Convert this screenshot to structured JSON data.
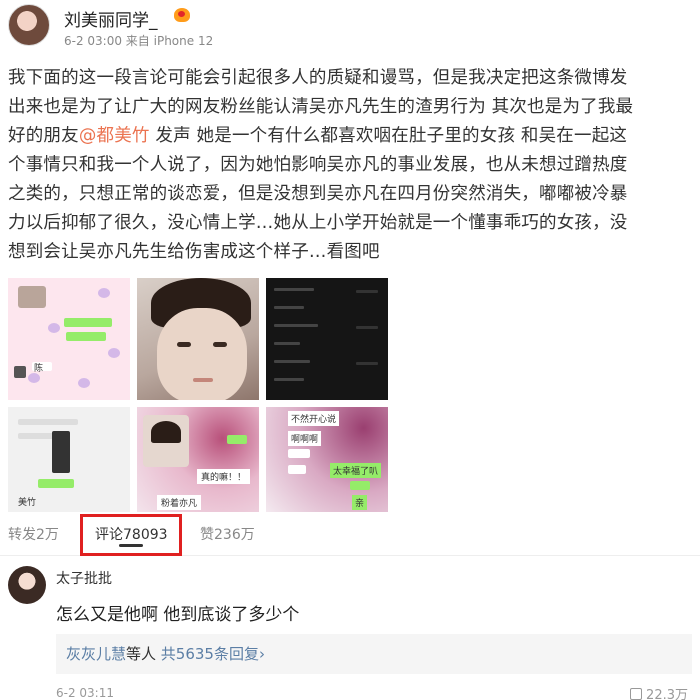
{
  "post": {
    "username": "刘美丽同学_",
    "meta": "6-2 03:00 来自 iPhone 12",
    "lines": [
      "我下面的这一段言论可能会引起很多人的质疑和谩骂，但是我决定把这条微博发",
      "出来也是为了让广大的网友粉丝能认清吴亦凡先生的渣男行为 其次也是为了我最",
      "好的朋友",
      "个事情只和我一个人说了，因为她怕影响吴亦凡的事业发展，也从未想过蹭热度",
      "之类的，只想正常的谈恋爱，但是没想到吴亦凡在四月份突然消失，嘟嘟被冷暴",
      "力以后抑郁了很久，没心情上学…她从上小学开始就是一个懂事乖巧的女孩，没",
      "想到会让吴亦凡先生给伤害成这个样子…看图吧"
    ],
    "mention": "@都美竹",
    "line3_rest": " 发声 她是一个有什么都喜欢咽在肚子里的女孩 和吴在一起这",
    "image_labels": {
      "img1": "陈",
      "img4": "美竹",
      "img5a": "真的嘛！！",
      "img5b": "粉着亦凡",
      "img6a": "不然开心说",
      "img6b": "啊啊啊",
      "img6c": "太幸福了叭",
      "img6d": "亲"
    }
  },
  "tabs": {
    "repost": "转发2万",
    "comment": "评论78093",
    "like": "赞236万"
  },
  "comment": {
    "name": "太子批批",
    "text": "怎么又是他啊 他到底谈了多少个",
    "replies_who": "灰灰儿慧",
    "replies_mid": "等人 ",
    "replies_count": "共5635条回复",
    "time": "6-2 03:11",
    "likes": "22.3万"
  },
  "colors": {
    "mention": "#eb7350",
    "highlight": "#e02020",
    "link": "#5b7ea5",
    "chat_green": "#95ec69"
  }
}
